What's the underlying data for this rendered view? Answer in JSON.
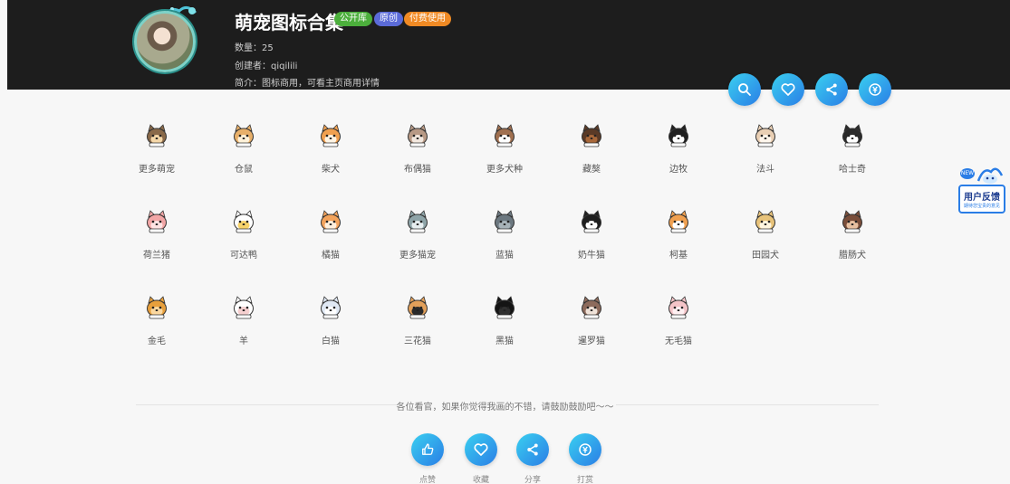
{
  "header": {
    "title": "萌宠图标合集",
    "badges": [
      "公开库",
      "原创",
      "付费使用"
    ],
    "count_label": "数量：25",
    "creator_label": "创建者：qiqilili",
    "intro_label": "简介：图标商用，可看主页商用详情"
  },
  "header_actions": [
    "search-icon",
    "heart-icon",
    "share-icon",
    "reward-icon"
  ],
  "icons": [
    {
      "label": "更多萌宠"
    },
    {
      "label": "仓鼠"
    },
    {
      "label": "柴犬"
    },
    {
      "label": "布偶猫"
    },
    {
      "label": "更多犬种"
    },
    {
      "label": "藏獒"
    },
    {
      "label": "边牧"
    },
    {
      "label": "法斗"
    },
    {
      "label": "哈士奇"
    },
    {
      "label": "荷兰猪"
    },
    {
      "label": "可达鸭"
    },
    {
      "label": "橘猫"
    },
    {
      "label": "更多猫宠"
    },
    {
      "label": "蓝猫"
    },
    {
      "label": "奶牛猫"
    },
    {
      "label": "柯基"
    },
    {
      "label": "田园犬"
    },
    {
      "label": "腊肠犬"
    },
    {
      "label": "金毛"
    },
    {
      "label": "羊"
    },
    {
      "label": "白猫"
    },
    {
      "label": "三花猫"
    },
    {
      "label": "黑猫"
    },
    {
      "label": "暹罗猫"
    },
    {
      "label": "无毛猫"
    }
  ],
  "feedback": {
    "new": "NEW",
    "title": "用户反馈",
    "subtitle": "期待您宝贵的意见"
  },
  "footer": {
    "encourage": "各位看官，如果你觉得我画的不错，请鼓励鼓励吧～～",
    "actions": [
      {
        "label": "点赞",
        "icon": "thumbs-up-icon"
      },
      {
        "label": "收藏",
        "icon": "heart-icon"
      },
      {
        "label": "分享",
        "icon": "share-icon"
      },
      {
        "label": "打赏",
        "icon": "reward-icon"
      }
    ]
  },
  "colors": {
    "accent_start": "#3ad0f0",
    "accent_end": "#2a7de6",
    "header_bg": "#1d1d1d"
  }
}
